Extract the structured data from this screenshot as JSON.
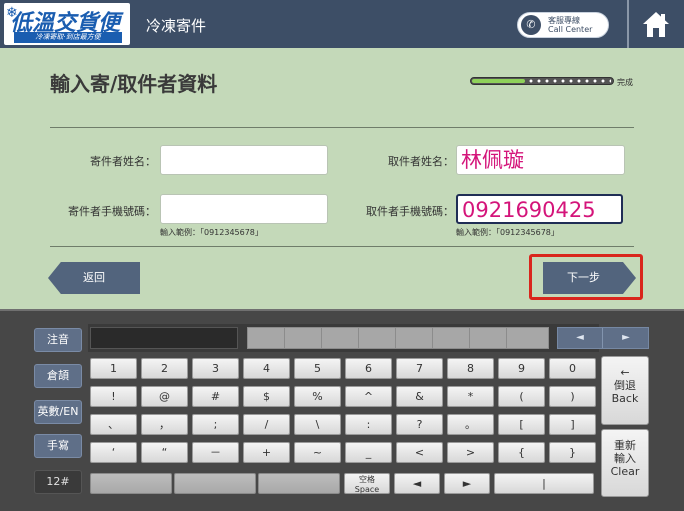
{
  "header": {
    "logo_main": "低溫交貨便",
    "logo_sub": "冷凍寄取·到店最方便",
    "title": "冷凍寄件",
    "call_center_zh": "客服專線",
    "call_center_en": "Call Center"
  },
  "form": {
    "title": "輸入寄/取件者資料",
    "progress_label": "完成",
    "progress_fraction": 0.38,
    "sender_name_label": "寄件者姓名：",
    "sender_name_value": "",
    "receiver_name_label": "取件者姓名：",
    "receiver_name_value": "林佩璇",
    "sender_phone_label": "寄件者手機號碼：",
    "sender_phone_value": "",
    "receiver_phone_label": "取件者手機號碼：",
    "receiver_phone_value": "0921690425",
    "sender_phone_hint": "輸入範例：「0912345678」",
    "receiver_phone_hint": "輸入範例：「0912345678」",
    "back_label": "返回",
    "next_label": "下一步"
  },
  "keyboard": {
    "modes": [
      "注音",
      "倉頡",
      "英數/EN",
      "手寫",
      "12#"
    ],
    "row1": [
      "1",
      "2",
      "3",
      "4",
      "5",
      "6",
      "7",
      "8",
      "9",
      "0"
    ],
    "row2": [
      "!",
      "@",
      "#",
      "$",
      "%",
      "^",
      "&",
      "*",
      "(",
      ")"
    ],
    "row3": [
      "、",
      "，",
      ";",
      "/",
      "\\",
      ":",
      "?",
      "。",
      "[",
      "]"
    ],
    "row4": [
      "‘",
      "“",
      "－",
      "+",
      "~",
      "_",
      "<",
      ">",
      "{",
      "}"
    ],
    "space_zh": "空格",
    "space_en": "Space",
    "left_arrow": "◄",
    "right_arrow": "►",
    "bar_key": "|",
    "backspace_arrow": "←",
    "backspace_zh": "倒退",
    "backspace_en": "Back",
    "clear_zh_1": "重新",
    "clear_zh_2": "輸入",
    "clear_en": "Clear",
    "candidate_prev": "◄",
    "candidate_next": "►"
  }
}
